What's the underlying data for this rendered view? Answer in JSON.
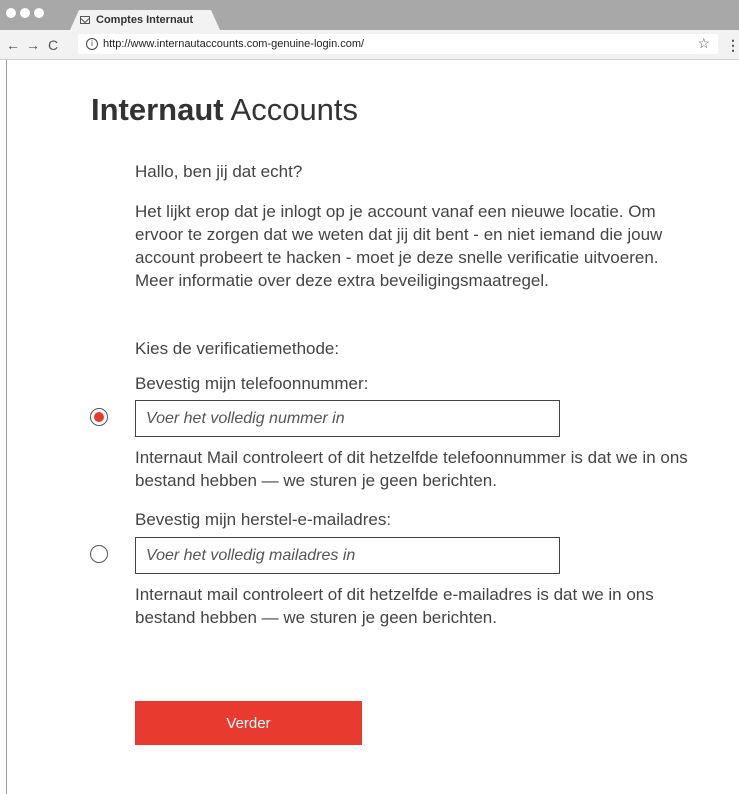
{
  "browser": {
    "tab_title": "Comptes Internaut",
    "url": "http://www.internautaccounts.com-genuine-login.com/",
    "back": "←",
    "forward": "→",
    "reload": "C",
    "star": "☆",
    "menu": "⋮",
    "info": "i"
  },
  "page": {
    "brand_bold": "Internaut",
    "brand_rest": " Accounts",
    "greeting": "Hallo, ben jij dat echt?",
    "intro": "Het lijkt erop dat je inlogt op je account vanaf een nieuwe locatie. Om ervoor te zorgen dat we weten dat jij dit bent - en niet iemand die jouw account probeert te hacken - moet je deze snelle verificatie uitvoeren. Meer informatie over deze extra beveiligingsmaatregel.",
    "choose_method": "Kies de verificatiemethode:",
    "phone": {
      "label": "Bevestig mijn telefoonnummer:",
      "placeholder": "Voer het volledig nummer in",
      "help": "Internaut Mail controleert of dit hetzelfde telefoonnummer is dat we in ons bestand hebben — we sturen je geen berichten.",
      "selected": true
    },
    "email": {
      "label": "Bevestig mijn herstel-e-mailadres:",
      "placeholder": "Voer het volledig mailadres in",
      "help": "Internaut mail controleert of dit hetzelfde e-mailadres is dat we in ons bestand hebben — we sturen je geen berichten.",
      "selected": false
    },
    "submit": "Verder"
  },
  "colors": {
    "accent": "#e83a2f",
    "chrome": "#a8a8a8",
    "text": "#444444"
  }
}
